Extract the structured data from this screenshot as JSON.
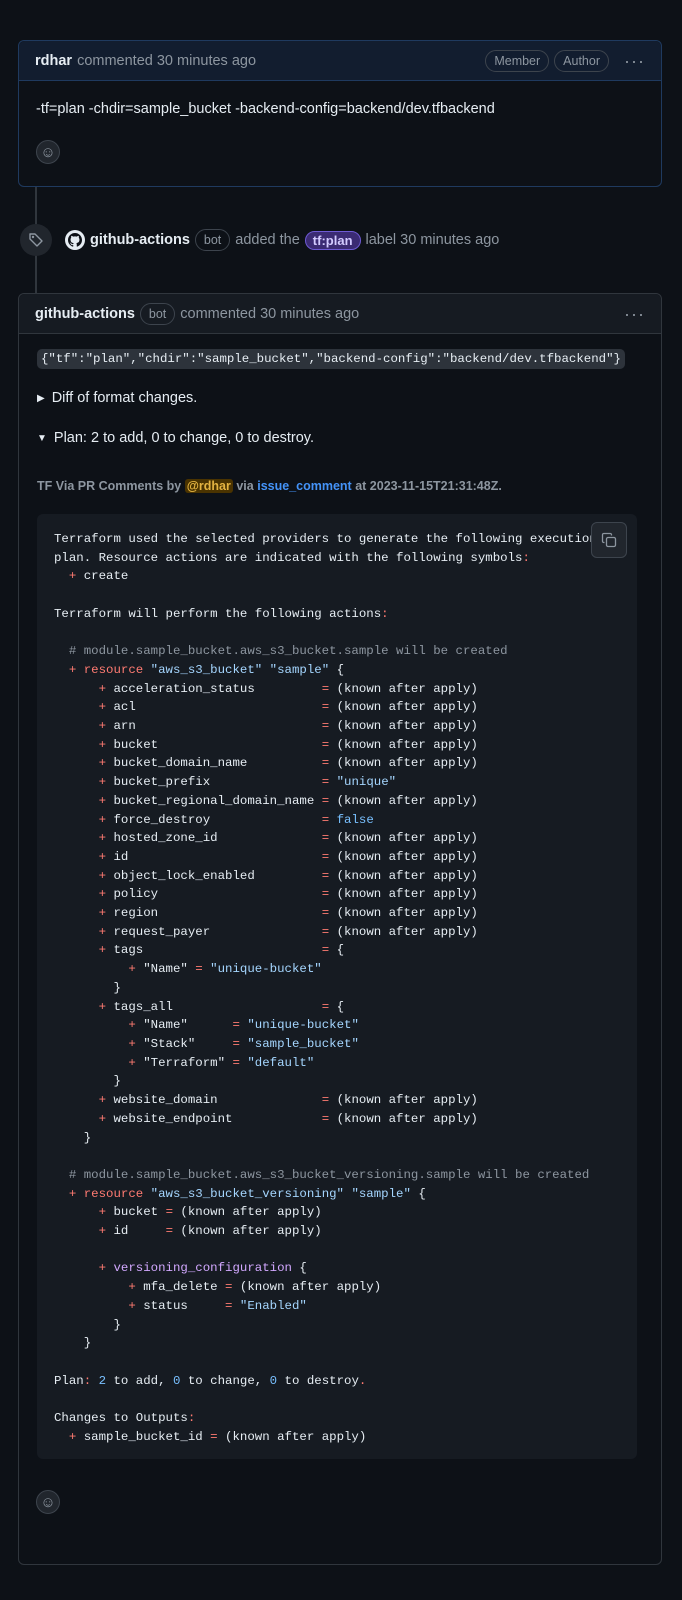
{
  "comment1": {
    "author": "rdhar",
    "meta": "commented 30 minutes ago",
    "badges": [
      "Member",
      "Author"
    ],
    "menu": "···",
    "body": "-tf=plan -chdir=sample_bucket -backend-config=backend/dev.tfbackend",
    "reaction": "☺"
  },
  "event": {
    "actor": "github-actions",
    "bot_badge": "bot",
    "action": "added the",
    "label": "tf:plan",
    "suffix": "label 30 minutes ago"
  },
  "comment2": {
    "author": "github-actions",
    "bot_badge": "bot",
    "meta": "commented 30 minutes ago",
    "menu": "···",
    "inline_code": "{\"tf\":\"plan\",\"chdir\":\"sample_bucket\",\"backend-config\":\"backend/dev.tfbackend\"}",
    "details_collapsed": "Diff of format changes.",
    "details_open": "Plan: 2 to add, 0 to change, 0 to destroy.",
    "byline_prefix": "TF Via PR Comments by",
    "byline_mention": "@rdhar",
    "byline_via": "via",
    "byline_link": "issue_comment",
    "byline_suffix": "at 2023-11-15T21:31:48Z.",
    "reaction": "☺"
  },
  "plan_lines": [
    [
      [
        "Terraform used the selected providers to generate the following execution",
        ""
      ]
    ],
    [
      [
        "plan. Resource actions are indicated with the following symbols",
        ""
      ],
      [
        ":",
        "r"
      ]
    ],
    [
      [
        "  ",
        ""
      ],
      [
        "+",
        "r"
      ],
      [
        " create",
        ""
      ]
    ],
    [
      [
        "",
        ""
      ]
    ],
    [
      [
        "Terraform will perform the following actions",
        ""
      ],
      [
        ":",
        "r"
      ]
    ],
    [
      [
        "",
        ""
      ]
    ],
    [
      [
        "  # module.sample_bucket.aws_s3_bucket.sample will be created",
        "c"
      ]
    ],
    [
      [
        "  ",
        ""
      ],
      [
        "+ resource",
        "r"
      ],
      [
        " ",
        ""
      ],
      [
        "\"aws_s3_bucket\"",
        "s"
      ],
      [
        " ",
        ""
      ],
      [
        "\"sample\"",
        "s"
      ],
      [
        " {",
        ""
      ]
    ],
    [
      [
        "      ",
        ""
      ],
      [
        "+",
        "r"
      ],
      [
        " acceleration_status         ",
        ""
      ],
      [
        "=",
        "r"
      ],
      [
        " (known after apply)",
        ""
      ]
    ],
    [
      [
        "      ",
        ""
      ],
      [
        "+",
        "r"
      ],
      [
        " acl                         ",
        ""
      ],
      [
        "=",
        "r"
      ],
      [
        " (known after apply)",
        ""
      ]
    ],
    [
      [
        "      ",
        ""
      ],
      [
        "+",
        "r"
      ],
      [
        " arn                         ",
        ""
      ],
      [
        "=",
        "r"
      ],
      [
        " (known after apply)",
        ""
      ]
    ],
    [
      [
        "      ",
        ""
      ],
      [
        "+",
        "r"
      ],
      [
        " bucket                      ",
        ""
      ],
      [
        "=",
        "r"
      ],
      [
        " (known after apply)",
        ""
      ]
    ],
    [
      [
        "      ",
        ""
      ],
      [
        "+",
        "r"
      ],
      [
        " bucket_domain_name          ",
        ""
      ],
      [
        "=",
        "r"
      ],
      [
        " (known after apply)",
        ""
      ]
    ],
    [
      [
        "      ",
        ""
      ],
      [
        "+",
        "r"
      ],
      [
        " bucket_prefix               ",
        ""
      ],
      [
        "=",
        "r"
      ],
      [
        " ",
        ""
      ],
      [
        "\"unique\"",
        "s"
      ]
    ],
    [
      [
        "      ",
        ""
      ],
      [
        "+",
        "r"
      ],
      [
        " bucket_regional_domain_name ",
        ""
      ],
      [
        "=",
        "r"
      ],
      [
        " (known after apply)",
        ""
      ]
    ],
    [
      [
        "      ",
        ""
      ],
      [
        "+",
        "r"
      ],
      [
        " force_destroy               ",
        ""
      ],
      [
        "=",
        "r"
      ],
      [
        " ",
        ""
      ],
      [
        "false",
        "b"
      ]
    ],
    [
      [
        "      ",
        ""
      ],
      [
        "+",
        "r"
      ],
      [
        " hosted_zone_id              ",
        ""
      ],
      [
        "=",
        "r"
      ],
      [
        " (known after apply)",
        ""
      ]
    ],
    [
      [
        "      ",
        ""
      ],
      [
        "+",
        "r"
      ],
      [
        " id                          ",
        ""
      ],
      [
        "=",
        "r"
      ],
      [
        " (known after apply)",
        ""
      ]
    ],
    [
      [
        "      ",
        ""
      ],
      [
        "+",
        "r"
      ],
      [
        " object_lock_enabled         ",
        ""
      ],
      [
        "=",
        "r"
      ],
      [
        " (known after apply)",
        ""
      ]
    ],
    [
      [
        "      ",
        ""
      ],
      [
        "+",
        "r"
      ],
      [
        " policy                      ",
        ""
      ],
      [
        "=",
        "r"
      ],
      [
        " (known after apply)",
        ""
      ]
    ],
    [
      [
        "      ",
        ""
      ],
      [
        "+",
        "r"
      ],
      [
        " region                      ",
        ""
      ],
      [
        "=",
        "r"
      ],
      [
        " (known after apply)",
        ""
      ]
    ],
    [
      [
        "      ",
        ""
      ],
      [
        "+",
        "r"
      ],
      [
        " request_payer               ",
        ""
      ],
      [
        "=",
        "r"
      ],
      [
        " (known after apply)",
        ""
      ]
    ],
    [
      [
        "      ",
        ""
      ],
      [
        "+",
        "r"
      ],
      [
        " tags                        ",
        ""
      ],
      [
        "=",
        "r"
      ],
      [
        " {",
        ""
      ]
    ],
    [
      [
        "          ",
        ""
      ],
      [
        "+",
        "r"
      ],
      [
        " \"Name\" ",
        ""
      ],
      [
        "=",
        "r"
      ],
      [
        " ",
        ""
      ],
      [
        "\"unique-bucket\"",
        "s"
      ]
    ],
    [
      [
        "        }",
        ""
      ]
    ],
    [
      [
        "      ",
        ""
      ],
      [
        "+",
        "r"
      ],
      [
        " tags_all                    ",
        ""
      ],
      [
        "=",
        "r"
      ],
      [
        " {",
        ""
      ]
    ],
    [
      [
        "          ",
        ""
      ],
      [
        "+",
        "r"
      ],
      [
        " \"Name\"      ",
        ""
      ],
      [
        "=",
        "r"
      ],
      [
        " ",
        ""
      ],
      [
        "\"unique-bucket\"",
        "s"
      ]
    ],
    [
      [
        "          ",
        ""
      ],
      [
        "+",
        "r"
      ],
      [
        " \"Stack\"     ",
        ""
      ],
      [
        "=",
        "r"
      ],
      [
        " ",
        ""
      ],
      [
        "\"sample_bucket\"",
        "s"
      ]
    ],
    [
      [
        "          ",
        ""
      ],
      [
        "+",
        "r"
      ],
      [
        " \"Terraform\" ",
        ""
      ],
      [
        "=",
        "r"
      ],
      [
        " ",
        ""
      ],
      [
        "\"default\"",
        "s"
      ]
    ],
    [
      [
        "        }",
        ""
      ]
    ],
    [
      [
        "      ",
        ""
      ],
      [
        "+",
        "r"
      ],
      [
        " website_domain              ",
        ""
      ],
      [
        "=",
        "r"
      ],
      [
        " (known after apply)",
        ""
      ]
    ],
    [
      [
        "      ",
        ""
      ],
      [
        "+",
        "r"
      ],
      [
        " website_endpoint            ",
        ""
      ],
      [
        "=",
        "r"
      ],
      [
        " (known after apply)",
        ""
      ]
    ],
    [
      [
        "    }",
        ""
      ]
    ],
    [
      [
        "",
        ""
      ]
    ],
    [
      [
        "  # module.sample_bucket.aws_s3_bucket_versioning.sample will be created",
        "c"
      ]
    ],
    [
      [
        "  ",
        ""
      ],
      [
        "+ resource",
        "r"
      ],
      [
        " ",
        ""
      ],
      [
        "\"aws_s3_bucket_versioning\"",
        "s"
      ],
      [
        " ",
        ""
      ],
      [
        "\"sample\"",
        "s"
      ],
      [
        " {",
        ""
      ]
    ],
    [
      [
        "      ",
        ""
      ],
      [
        "+",
        "r"
      ],
      [
        " bucket ",
        ""
      ],
      [
        "=",
        "r"
      ],
      [
        " (known after apply)",
        ""
      ]
    ],
    [
      [
        "      ",
        ""
      ],
      [
        "+",
        "r"
      ],
      [
        " id     ",
        ""
      ],
      [
        "=",
        "r"
      ],
      [
        " (known after apply)",
        ""
      ]
    ],
    [
      [
        "",
        ""
      ]
    ],
    [
      [
        "      ",
        ""
      ],
      [
        "+",
        "r"
      ],
      [
        " ",
        ""
      ],
      [
        "versioning_configuration",
        "p"
      ],
      [
        " {",
        ""
      ]
    ],
    [
      [
        "          ",
        ""
      ],
      [
        "+",
        "r"
      ],
      [
        " mfa_delete ",
        ""
      ],
      [
        "=",
        "r"
      ],
      [
        " (known after apply)",
        ""
      ]
    ],
    [
      [
        "          ",
        ""
      ],
      [
        "+",
        "r"
      ],
      [
        " status     ",
        ""
      ],
      [
        "=",
        "r"
      ],
      [
        " ",
        ""
      ],
      [
        "\"Enabled\"",
        "s"
      ]
    ],
    [
      [
        "        }",
        ""
      ]
    ],
    [
      [
        "    }",
        ""
      ]
    ],
    [
      [
        "",
        ""
      ]
    ],
    [
      [
        "Plan",
        ""
      ],
      [
        ":",
        "r"
      ],
      [
        " ",
        ""
      ],
      [
        "2",
        "b"
      ],
      [
        " to add, ",
        ""
      ],
      [
        "0",
        "b"
      ],
      [
        " to change, ",
        ""
      ],
      [
        "0",
        "b"
      ],
      [
        " to destroy",
        ""
      ],
      [
        ".",
        "r"
      ]
    ],
    [
      [
        "",
        ""
      ]
    ],
    [
      [
        "Changes to Outputs",
        ""
      ],
      [
        ":",
        "r"
      ]
    ],
    [
      [
        "  ",
        ""
      ],
      [
        "+",
        "r"
      ],
      [
        " sample_bucket_id ",
        ""
      ],
      [
        "=",
        "r"
      ],
      [
        " (known after apply)",
        ""
      ]
    ]
  ]
}
